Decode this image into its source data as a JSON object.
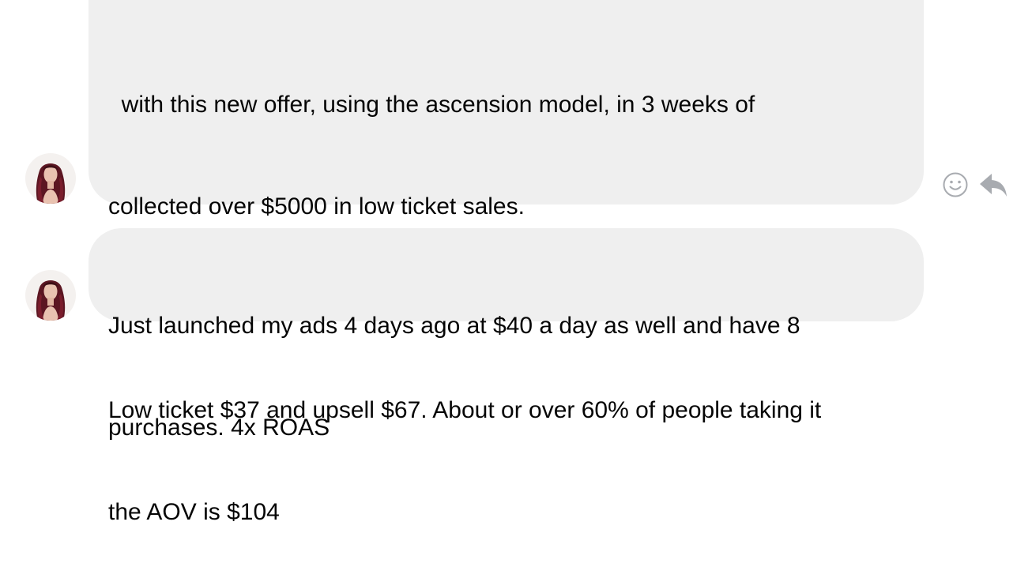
{
  "messages": [
    {
      "lines": [
        "  with this new offer, using the ascension model, in 3 weeks of",
        "collected over $5000 in low ticket sales.",
        "",
        "Low ticket $37 and upsell $67. About or over 60% of people taking it",
        "the AOV is $104"
      ]
    },
    {
      "lines": [
        "Just launched my ads 4 days ago at $40 a day as well and have 8",
        "purchases. 4x ROAS"
      ]
    }
  ],
  "actions": {
    "react_icon": "smiley-face-icon",
    "reply_icon": "reply-arrow-icon"
  },
  "colors": {
    "bubble_background": "#efefef",
    "text": "#050505",
    "action_icon": "#a8abb0",
    "avatar_hair": "#5c1622",
    "avatar_skin": "#e9c2b0"
  }
}
